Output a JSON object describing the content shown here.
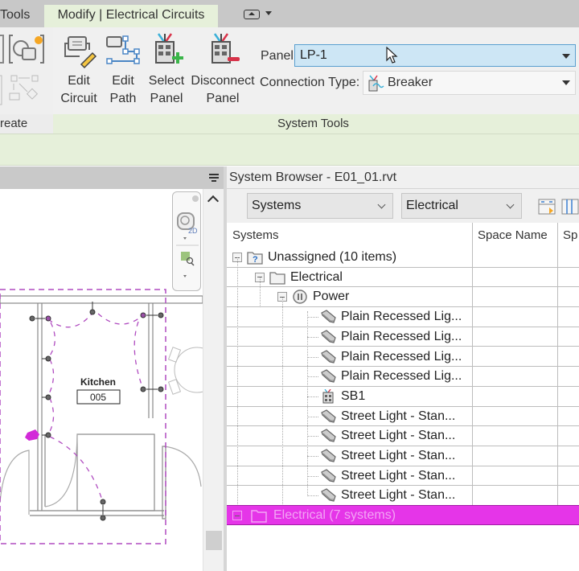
{
  "ribbon": {
    "tabs": [
      {
        "label": "Tools"
      },
      {
        "label": "Modify | Electrical Circuits",
        "active": true
      }
    ],
    "buttons": [
      {
        "label_line1": "Edit",
        "label_line2": "Circuit",
        "icon": "edit-circuit-icon"
      },
      {
        "label_line1": "Edit",
        "label_line2": "Path",
        "icon": "edit-path-icon"
      },
      {
        "label_line1": "Select",
        "label_line2": "Panel",
        "icon": "select-panel-icon"
      },
      {
        "label_line1": "Disconnect",
        "label_line2": "Panel",
        "icon": "disconnect-panel-icon"
      }
    ],
    "panel_label": "Panel:",
    "panel_value": "LP-1",
    "connection_label": "Connection Type:",
    "connection_value": "Breaker",
    "group_create": "reate",
    "group_system_tools": "System Tools"
  },
  "view": {
    "room_name": "Kitchen",
    "room_number": "005",
    "highlight_color": "#b04cc0"
  },
  "system_browser": {
    "title": "System Browser - E01_01.rvt",
    "view_combo": "Systems",
    "discipline_combo": "Electrical",
    "columns": [
      "Systems",
      "Space Name",
      "Sp"
    ],
    "rows": [
      {
        "label": "Unassigned (10 items)",
        "icon": "unassigned-folder-icon",
        "level": 0,
        "expand": "minus"
      },
      {
        "label": "Electrical",
        "icon": "folder-icon",
        "level": 1,
        "expand": "minus"
      },
      {
        "label": "Power",
        "icon": "power-system-icon",
        "level": 2,
        "expand": "minus"
      },
      {
        "label": "Plain Recessed Lig...",
        "icon": "light-fixture-icon",
        "level": 3
      },
      {
        "label": "Plain Recessed Lig...",
        "icon": "light-fixture-icon",
        "level": 3
      },
      {
        "label": "Plain Recessed Lig...",
        "icon": "light-fixture-icon",
        "level": 3
      },
      {
        "label": "Plain Recessed Lig...",
        "icon": "light-fixture-icon",
        "level": 3
      },
      {
        "label": "SB1",
        "icon": "panel-icon",
        "level": 3
      },
      {
        "label": "Street Light - Stan...",
        "icon": "light-fixture-icon",
        "level": 3
      },
      {
        "label": "Street Light - Stan...",
        "icon": "light-fixture-icon",
        "level": 3
      },
      {
        "label": "Street Light - Stan...",
        "icon": "light-fixture-icon",
        "level": 3
      },
      {
        "label": "Street Light - Stan...",
        "icon": "light-fixture-icon",
        "level": 3
      },
      {
        "label": "Street Light - Stan...",
        "icon": "light-fixture-icon",
        "level": 3
      }
    ],
    "selected_row": {
      "label": "Electrical (7 systems)",
      "icon": "folder-icon",
      "expand": "plus"
    },
    "selection_color": "#e535e8"
  }
}
